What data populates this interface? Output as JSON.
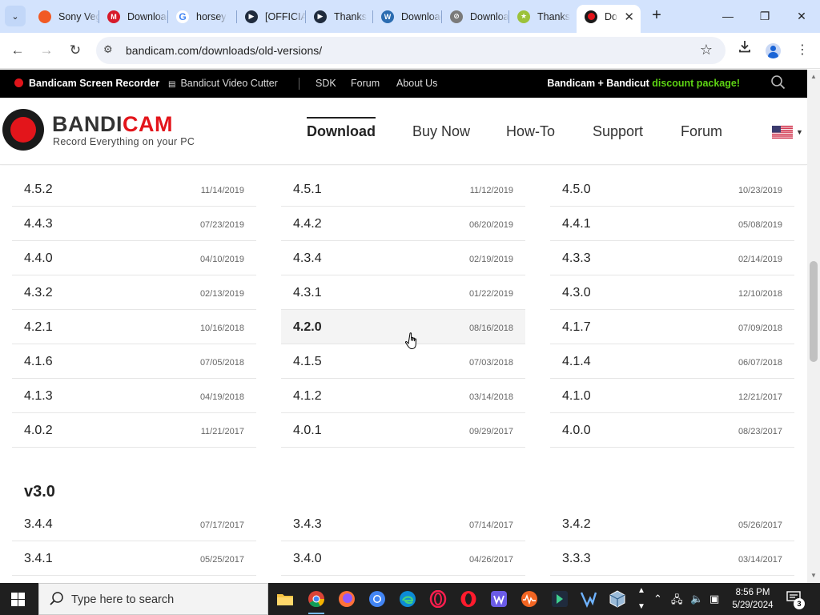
{
  "browser": {
    "tabs": [
      {
        "title": "Sony Vegas",
        "favicon_color": "#f15a24",
        "favicon_glyph": ""
      },
      {
        "title": "Download",
        "favicon_color": "#d71a2b",
        "favicon_glyph": "M"
      },
      {
        "title": "horsey",
        "favicon_color": "#ffffff",
        "favicon_glyph": "G"
      },
      {
        "title": "[OFFICIAL]",
        "favicon_color": "#1f2b3d",
        "favicon_glyph": "▶"
      },
      {
        "title": "Thanks",
        "favicon_color": "#1f2b3d",
        "favicon_glyph": "▶"
      },
      {
        "title": "Download",
        "favicon_color": "#2b6cb0",
        "favicon_glyph": "W"
      },
      {
        "title": "Download",
        "favicon_color": "#7a7a7a",
        "favicon_glyph": "⊘"
      },
      {
        "title": "Thanks",
        "favicon_color": "#9cc23a",
        "favicon_glyph": "★"
      },
      {
        "title": "Do",
        "favicon_color": "#e3151b",
        "favicon_glyph": ""
      }
    ],
    "active_tab_close": "✕",
    "new_tab": "+",
    "window": {
      "minimize": "—",
      "maximize": "❐",
      "close": "✕"
    },
    "url": "bandicam.com/downloads/old-versions/"
  },
  "site": {
    "topbar": {
      "recorder": "Bandicam Screen Recorder",
      "cutter": "Bandicut Video Cutter",
      "sdk": "SDK",
      "forum": "Forum",
      "about": "About Us",
      "promo_prefix": "Bandicam + Bandicut ",
      "promo_highlight": "discount package!"
    },
    "logo": {
      "part1": "BANDI",
      "part2": "CAM",
      "tagline": "Record Everything on your PC"
    },
    "nav": {
      "download": "Download",
      "buy": "Buy Now",
      "howto": "How-To",
      "support": "Support",
      "forum": "Forum"
    }
  },
  "versions_v4": [
    [
      {
        "version": "4.5.2",
        "date": "11/14/2019"
      },
      {
        "version": "4.4.3",
        "date": "07/23/2019"
      },
      {
        "version": "4.4.0",
        "date": "04/10/2019"
      },
      {
        "version": "4.3.2",
        "date": "02/13/2019"
      },
      {
        "version": "4.2.1",
        "date": "10/16/2018"
      },
      {
        "version": "4.1.6",
        "date": "07/05/2018"
      },
      {
        "version": "4.1.3",
        "date": "04/19/2018"
      },
      {
        "version": "4.0.2",
        "date": "11/21/2017"
      }
    ],
    [
      {
        "version": "4.5.1",
        "date": "11/12/2019"
      },
      {
        "version": "4.4.2",
        "date": "06/20/2019"
      },
      {
        "version": "4.3.4",
        "date": "02/19/2019"
      },
      {
        "version": "4.3.1",
        "date": "01/22/2019"
      },
      {
        "version": "4.2.0",
        "date": "08/16/2018"
      },
      {
        "version": "4.1.5",
        "date": "07/03/2018"
      },
      {
        "version": "4.1.2",
        "date": "03/14/2018"
      },
      {
        "version": "4.0.1",
        "date": "09/29/2017"
      }
    ],
    [
      {
        "version": "4.5.0",
        "date": "10/23/2019"
      },
      {
        "version": "4.4.1",
        "date": "05/08/2019"
      },
      {
        "version": "4.3.3",
        "date": "02/14/2019"
      },
      {
        "version": "4.3.0",
        "date": "12/10/2018"
      },
      {
        "version": "4.1.7",
        "date": "07/09/2018"
      },
      {
        "version": "4.1.4",
        "date": "06/07/2018"
      },
      {
        "version": "4.1.0",
        "date": "12/21/2017"
      },
      {
        "version": "4.0.0",
        "date": "08/23/2017"
      }
    ]
  ],
  "v3_section_title": "v3.0",
  "versions_v3": [
    [
      {
        "version": "3.4.4",
        "date": "07/17/2017"
      },
      {
        "version": "3.4.1",
        "date": "05/25/2017"
      }
    ],
    [
      {
        "version": "3.4.3",
        "date": "07/14/2017"
      },
      {
        "version": "3.4.0",
        "date": "04/26/2017"
      }
    ],
    [
      {
        "version": "3.4.2",
        "date": "05/26/2017"
      },
      {
        "version": "3.3.3",
        "date": "03/14/2017"
      }
    ]
  ],
  "hovered_version": "4.2.0",
  "taskbar": {
    "search_placeholder": "Type here to search",
    "apps": [
      "file-explorer",
      "chrome",
      "firefox",
      "chrome-alt",
      "edge",
      "opera-gx",
      "opera",
      "app-w",
      "audio-app",
      "vscode-like",
      "app-vx",
      "virtualbox"
    ],
    "time": "8:56 PM",
    "date": "5/29/2024",
    "notification_count": "3"
  },
  "colors": {
    "brand_red": "#e3151b",
    "promo_green": "#5dd313",
    "tab_bar": "#d3e3fd"
  }
}
